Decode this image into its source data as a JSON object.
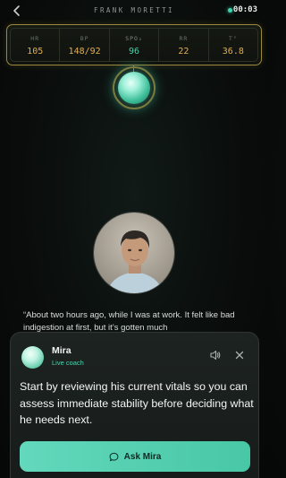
{
  "header": {
    "back_icon": "chevron-left",
    "patient_name": "FRANK MORETTI",
    "timer": "00:03",
    "recording_color": "#3ad6ad"
  },
  "vitals": [
    {
      "label": "HR",
      "value": "105"
    },
    {
      "label": "BP",
      "value": "148/92"
    },
    {
      "label": "SPO₂",
      "value": "96"
    },
    {
      "label": "RR",
      "value": "22"
    },
    {
      "label": "T°",
      "value": "36.8"
    }
  ],
  "patient": {
    "quote": "“About two hours ago, while I was at work. It felt like bad indigestion at first, but it’s gotten much"
  },
  "coach": {
    "name": "Mira",
    "role": "Live coach",
    "message": "Start by reviewing his current vitals so you can assess immediate stability before deciding what he needs next.",
    "button_label": "Ask Mira",
    "button_icon": "chat-bubble-icon",
    "accent_color": "#4fd0ad"
  }
}
